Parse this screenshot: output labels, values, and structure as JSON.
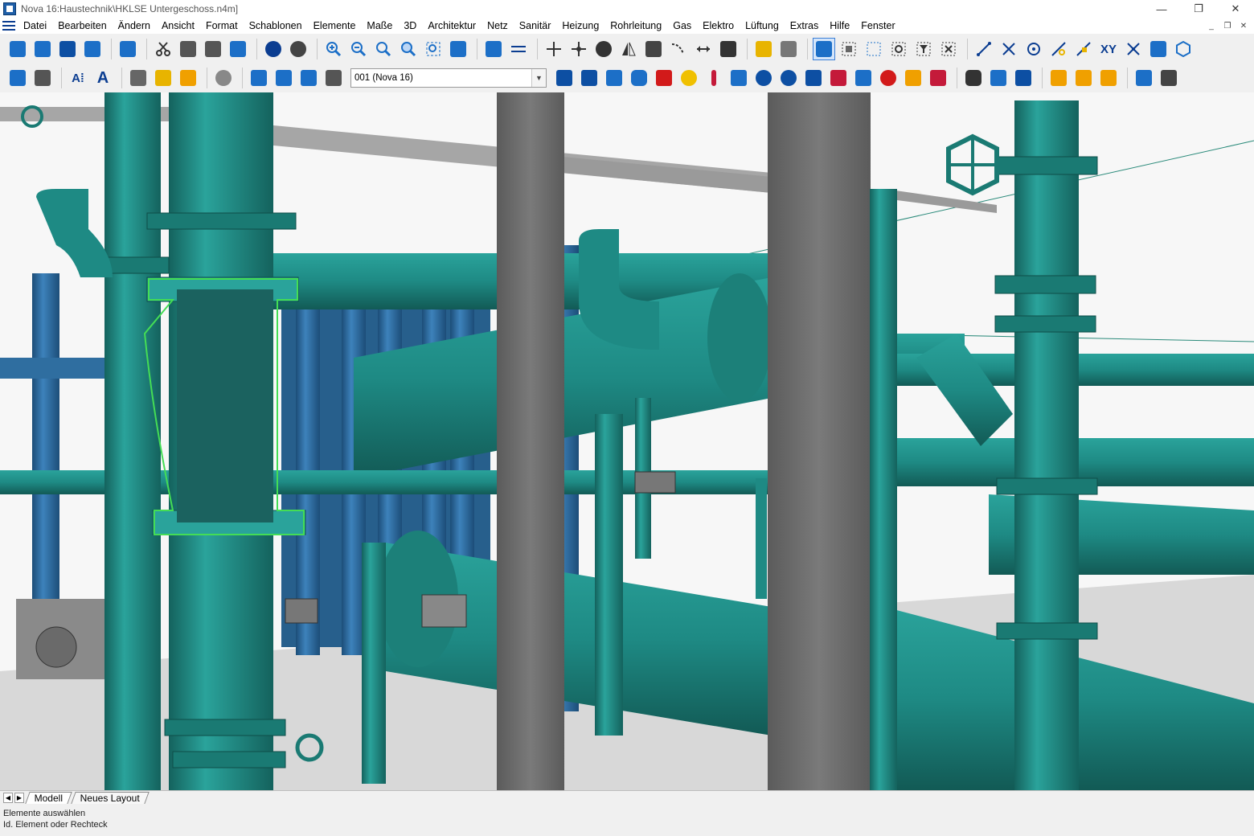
{
  "window": {
    "title": "Nova 16:Haustechnik\\HKLSE Untergeschoss.n4m]",
    "minimize_glyph": "—",
    "restore_glyph": "❐",
    "close_glyph": "✕"
  },
  "menu": {
    "items": [
      "Datei",
      "Bearbeiten",
      "Ändern",
      "Ansicht",
      "Format",
      "Schablonen",
      "Elemente",
      "Maße",
      "3D",
      "Architektur",
      "Netz",
      "Sanitär",
      "Heizung",
      "Rohrleitung",
      "Gas",
      "Elektro",
      "Lüftung",
      "Extras",
      "Hilfe",
      "Fenster"
    ]
  },
  "toolbar2": {
    "layer_select_value": "001 (Nova 16)",
    "xy_label": "XY"
  },
  "tabs": {
    "items": [
      "Modell",
      "Neues Layout"
    ],
    "active_index": 0
  },
  "status": {
    "line1": "Elemente auswählen",
    "line2": "Id. Element oder Rechteck"
  },
  "colors": {
    "pipe_teal": "#1e8a84",
    "pipe_blue": "#2f6ea0",
    "beam_gray": "#6e6e6e",
    "selection_green": "#44dd55",
    "accent_blue": "#0b3d91"
  }
}
